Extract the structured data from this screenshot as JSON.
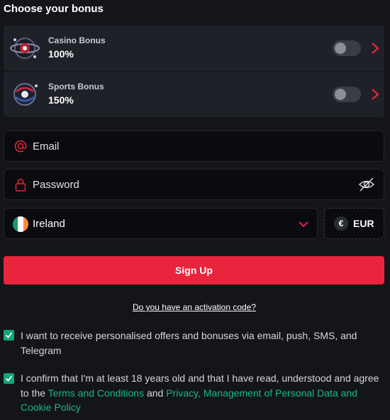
{
  "header": {
    "title": "Choose your bonus"
  },
  "bonuses": [
    {
      "name": "Casino Bonus",
      "value": "100%",
      "enabled": false
    },
    {
      "name": "Sports Bonus",
      "value": "150%",
      "enabled": false
    }
  ],
  "form": {
    "email_placeholder": "Email",
    "password_placeholder": "Password",
    "country": "Ireland",
    "currency_symbol": "€",
    "currency": "EUR"
  },
  "actions": {
    "signup_label": "Sign Up",
    "activation_link": "Do you have an activation code?"
  },
  "consents": {
    "offers_text": "I want to receive personalised offers and bonuses via email, push, SMS, and Telegram",
    "terms_prefix": "I confirm that I'm at least 18 years old and that I have read, understood and agree to the ",
    "terms_link": "Terms and Conditions",
    "and_word": " and ",
    "privacy_link": "Privacy, Management of Personal Data and Cookie Policy"
  },
  "colors": {
    "accent": "#e8253d",
    "check": "#12a37a",
    "link": "#19b68a",
    "background": "#141519"
  },
  "icons": [
    "casino-bonus-icon",
    "sports-bonus-icon",
    "chevron-right-icon",
    "at-sign-icon",
    "lock-icon",
    "eye-off-icon",
    "ireland-flag-icon",
    "chevron-down-icon",
    "euro-icon",
    "checkmark-icon"
  ]
}
